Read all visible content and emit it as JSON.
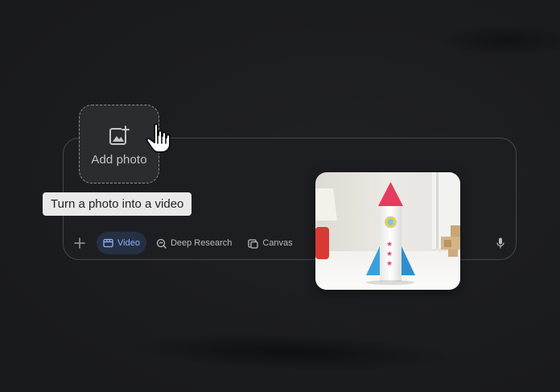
{
  "add_photo": {
    "label": "Add photo",
    "icon": "add-photo-icon"
  },
  "tooltip": {
    "text": "Turn a photo into a video"
  },
  "toolbar": {
    "plus_icon": "plus-icon",
    "tools": [
      {
        "label": "Video",
        "icon": "video-icon",
        "active": true
      },
      {
        "label": "Deep Research",
        "icon": "deep-research-icon",
        "active": false
      },
      {
        "label": "Canvas",
        "icon": "canvas-icon",
        "active": false
      }
    ],
    "mic_icon": "microphone-icon"
  },
  "colors": {
    "active_accent": "#8ab4f8",
    "active_bg": "#263043",
    "tooltip_bg": "#e9e9ea"
  }
}
